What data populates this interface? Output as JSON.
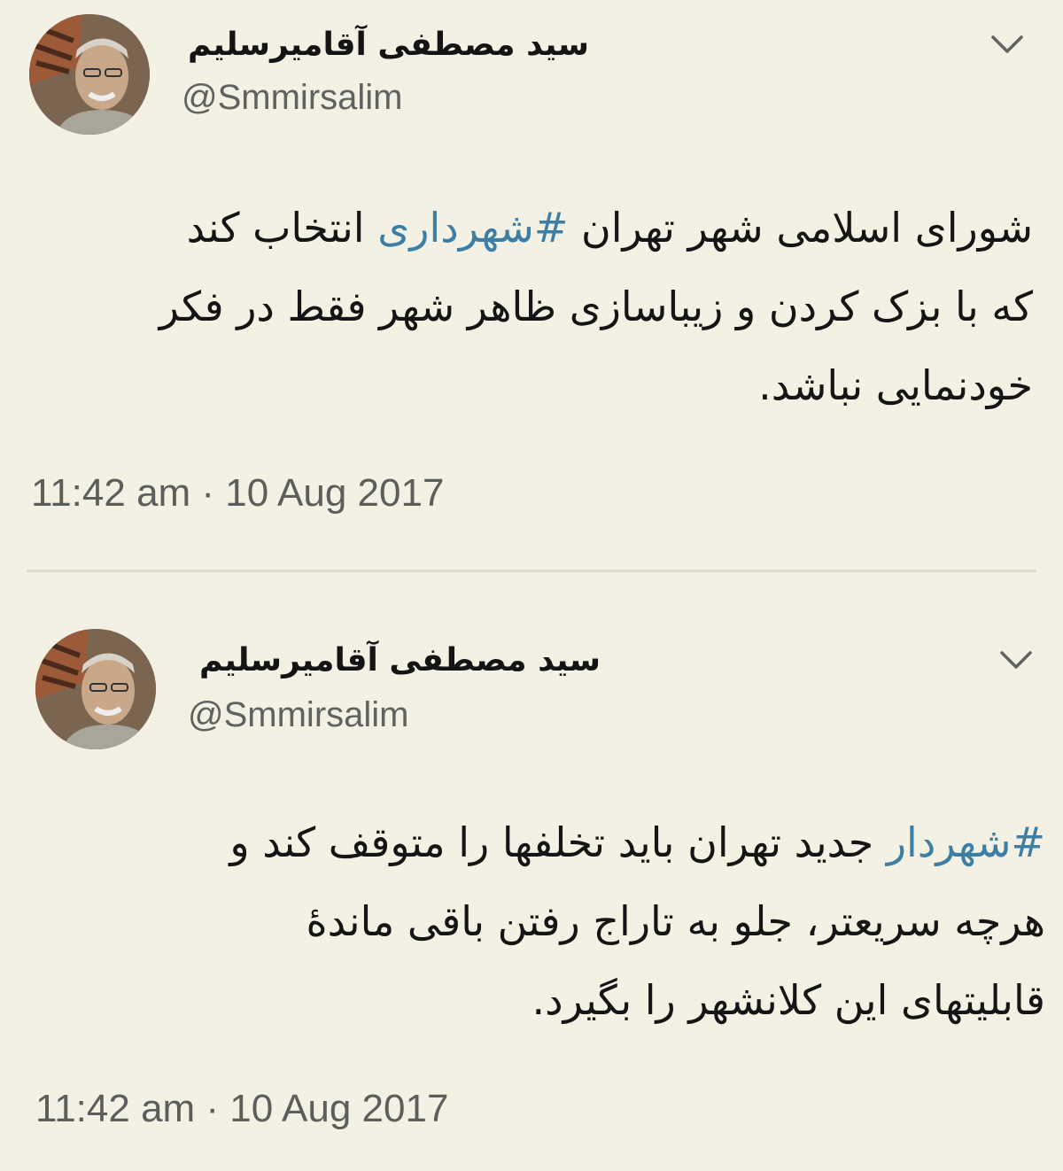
{
  "colors": {
    "background": "#f3f1e4",
    "hashtag": "#3d7ea5",
    "muted_text": "#5b5e5b",
    "divider": "#dcd9c9"
  },
  "tweets": [
    {
      "display_name": "سید مصطفی آقامیرسلیم",
      "handle": "@Smmirsalim",
      "menu_icon": "chevron-down-icon",
      "lines": [
        {
          "before": "شورای اسلامی شهر تهران ",
          "hashtag": "#شهرداری",
          "after": " انتخاب کند"
        },
        {
          "before": "که با بزک کردن و زیباسازی ظاهر شهر فقط در فکر",
          "hashtag": "",
          "after": ""
        },
        {
          "before": "خودنمایی نباشد.",
          "hashtag": "",
          "after": ""
        }
      ],
      "timestamp": "11:42 am · 10 Aug 2017"
    },
    {
      "display_name": "سید مصطفی آقامیرسلیم",
      "handle": "@Smmirsalim",
      "menu_icon": "chevron-down-icon",
      "lines": [
        {
          "before": "",
          "hashtag": "#شهردار",
          "after": " جدید تهران باید تخلفها را متوقف کند و"
        },
        {
          "before": "هرچه سریعتر، جلو به تاراج رفتن باقی ماندهٔ",
          "hashtag": "",
          "after": ""
        },
        {
          "before": "قابلیتهای این کلانشهر را بگیرد.",
          "hashtag": "",
          "after": ""
        }
      ],
      "timestamp": "11:42 am · 10 Aug 2017"
    }
  ]
}
